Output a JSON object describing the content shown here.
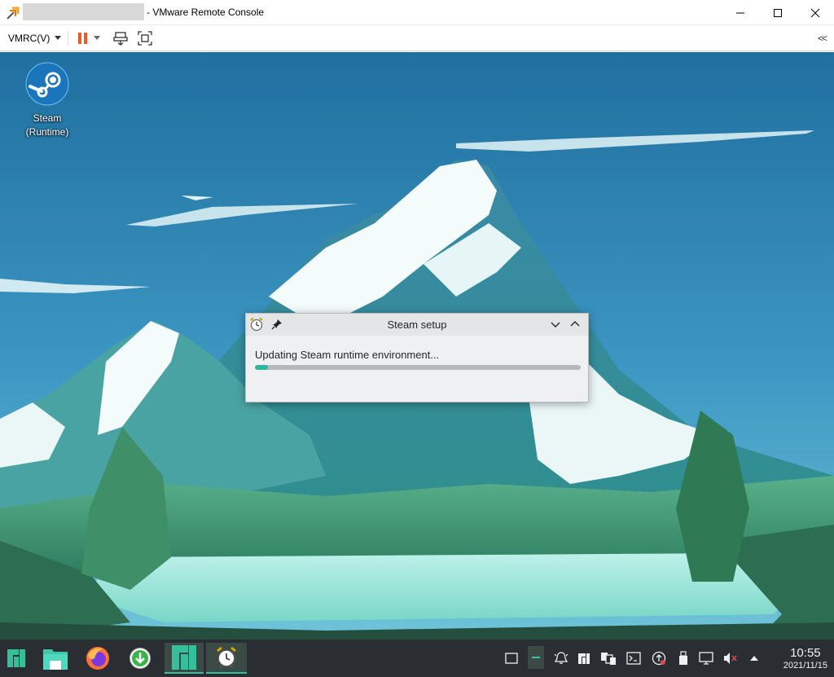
{
  "window": {
    "title": "- VMware Remote Console",
    "minimize_icon": "minimize-icon",
    "maximize_icon": "maximize-icon",
    "close_icon": "close-icon"
  },
  "toolbar": {
    "vmrc_menu_label": "VMRC(V)",
    "pause_icon": "pause-icon",
    "send_keys_icon": "send-ctrl-alt-del-icon",
    "fullscreen_icon": "fullscreen-icon",
    "collapse_label": "<<"
  },
  "desktop": {
    "icons": [
      {
        "label": "Steam\n(Runtime)",
        "icon": "steam-icon"
      }
    ]
  },
  "dialog": {
    "title": "Steam setup",
    "message": "Updating Steam runtime environment...",
    "progress": 0.04,
    "accent": "#2fb5a0"
  },
  "taskbar": {
    "launchers": [
      "manjaro-menu-icon",
      "file-manager-icon",
      "firefox-icon",
      "updater-icon",
      "manjaro-hello-icon",
      "steam-setup-alarm-icon"
    ],
    "tray": [
      "show-desktop-icon",
      "pager-icon",
      "notifications-icon",
      "manjaro-settings-icon",
      "clipboard-icon",
      "terminal-icon",
      "updates-icon",
      "usb-icon",
      "display-icon",
      "volume-muted-icon",
      "expand-tray-icon"
    ],
    "clock": {
      "time": "10:55",
      "date": "2021/11/15"
    }
  },
  "colors": {
    "sky_top": "#1f6f9f",
    "sky_bottom": "#5fb8d6",
    "taskbar": "#2a2e32",
    "manjaro_green": "#35bf9b"
  }
}
